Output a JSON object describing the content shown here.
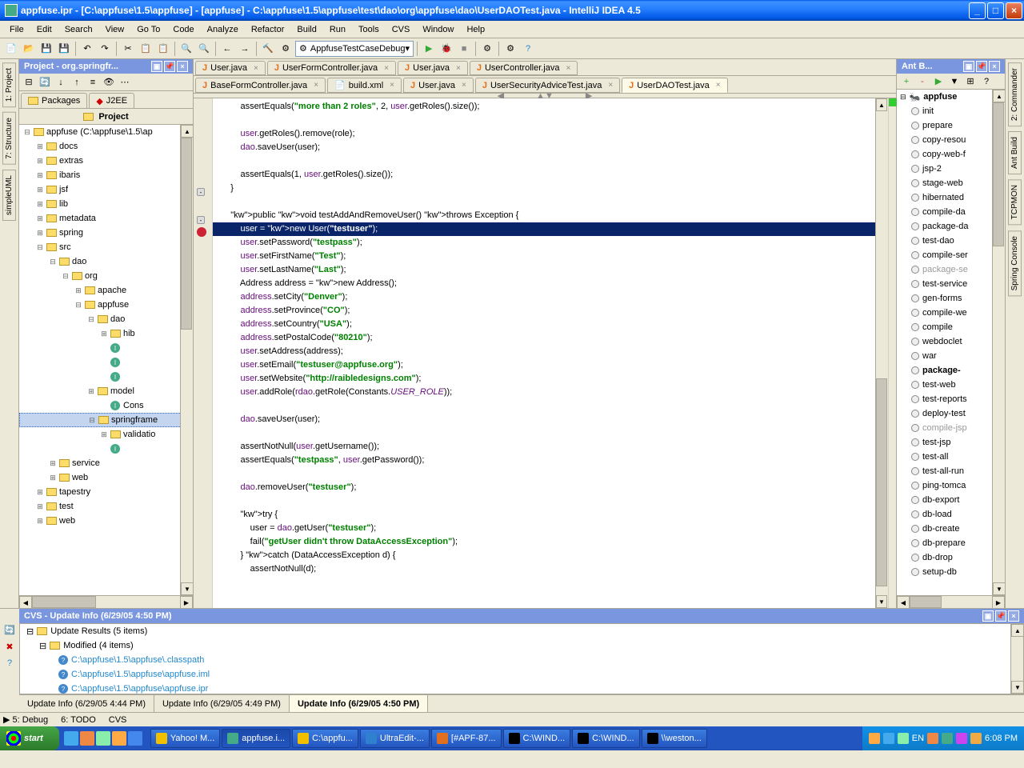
{
  "titlebar": {
    "text": "appfuse.ipr - [C:\\appfuse\\1.5\\appfuse] - [appfuse] - C:\\appfuse\\1.5\\appfuse\\test\\dao\\org\\appfuse\\dao\\UserDAOTest.java - IntelliJ IDEA 4.5"
  },
  "menu": [
    "File",
    "Edit",
    "Search",
    "View",
    "Go To",
    "Code",
    "Analyze",
    "Refactor",
    "Build",
    "Run",
    "Tools",
    "CVS",
    "Window",
    "Help"
  ],
  "toolbar": {
    "runconfig": "AppfuseTestCaseDebug"
  },
  "side_left": [
    "1: Project",
    "7: Structure",
    "simpleUML"
  ],
  "side_right": [
    "2: Commander",
    "Ant Build",
    "TCPMON",
    "Spring Console"
  ],
  "project": {
    "title": "Project - org.springfr...",
    "tabs": [
      "Packages",
      "J2EE"
    ],
    "header": "Project",
    "tree": [
      {
        "depth": 0,
        "exp": "-",
        "icon": "folder",
        "label": "appfuse (C:\\appfuse\\1.5\\ap"
      },
      {
        "depth": 1,
        "exp": "+",
        "icon": "folder",
        "label": "docs"
      },
      {
        "depth": 1,
        "exp": "+",
        "icon": "folder",
        "label": "extras"
      },
      {
        "depth": 1,
        "exp": "+",
        "icon": "folder",
        "label": "ibaris"
      },
      {
        "depth": 1,
        "exp": "+",
        "icon": "folder",
        "label": "jsf"
      },
      {
        "depth": 1,
        "exp": "+",
        "icon": "folder",
        "label": "lib"
      },
      {
        "depth": 1,
        "exp": "+",
        "icon": "folder",
        "label": "metadata"
      },
      {
        "depth": 1,
        "exp": "+",
        "icon": "folder",
        "label": "spring"
      },
      {
        "depth": 1,
        "exp": "-",
        "icon": "folder",
        "label": "src"
      },
      {
        "depth": 2,
        "exp": "-",
        "icon": "folder",
        "label": "dao"
      },
      {
        "depth": 3,
        "exp": "-",
        "icon": "folder",
        "label": "org"
      },
      {
        "depth": 4,
        "exp": "+",
        "icon": "folder",
        "label": "apache"
      },
      {
        "depth": 4,
        "exp": "-",
        "icon": "folder",
        "label": "appfuse"
      },
      {
        "depth": 5,
        "exp": "-",
        "icon": "folder",
        "label": "dao"
      },
      {
        "depth": 6,
        "exp": "+",
        "icon": "folder",
        "label": "hib"
      },
      {
        "depth": 6,
        "exp": "",
        "icon": "class",
        "label": ""
      },
      {
        "depth": 6,
        "exp": "",
        "icon": "class",
        "label": ""
      },
      {
        "depth": 6,
        "exp": "",
        "icon": "class",
        "label": ""
      },
      {
        "depth": 5,
        "exp": "+",
        "icon": "folder",
        "label": "model"
      },
      {
        "depth": 6,
        "exp": "",
        "icon": "class",
        "label": "Cons"
      },
      {
        "depth": 5,
        "exp": "-",
        "icon": "folder",
        "label": "springframe",
        "selected": true
      },
      {
        "depth": 6,
        "exp": "+",
        "icon": "folder",
        "label": "validatio"
      },
      {
        "depth": 6,
        "exp": "",
        "icon": "class",
        "label": ""
      },
      {
        "depth": 2,
        "exp": "+",
        "icon": "folder",
        "label": "service"
      },
      {
        "depth": 2,
        "exp": "+",
        "icon": "folder",
        "label": "web"
      },
      {
        "depth": 1,
        "exp": "+",
        "icon": "folder",
        "label": "tapestry"
      },
      {
        "depth": 1,
        "exp": "+",
        "icon": "folder",
        "label": "test"
      },
      {
        "depth": 1,
        "exp": "+",
        "icon": "folder",
        "label": "web"
      }
    ]
  },
  "editor": {
    "tabs_row1": [
      "User.java",
      "UserFormController.java",
      "User.java",
      "UserController.java"
    ],
    "tabs_row2": [
      "BaseFormController.java",
      "build.xml",
      "User.java",
      "UserSecurityAdviceTest.java",
      "UserDAOTest.java"
    ],
    "active_tab": "UserDAOTest.java"
  },
  "code_lines": [
    {
      "t": "        assertEquals(\"more than 2 roles\", 2, user.getRoles().size());",
      "h": [
        "str:more than 2 roles",
        "id:user"
      ]
    },
    {
      "t": ""
    },
    {
      "t": "        user.getRoles().remove(role);"
    },
    {
      "t": "        dao.saveUser(user);"
    },
    {
      "t": ""
    },
    {
      "t": "        assertEquals(1, user.getRoles().size());"
    },
    {
      "t": "    }"
    },
    {
      "t": ""
    },
    {
      "t": "    public void testAddAndRemoveUser() throws Exception {",
      "kw": [
        "public",
        "void",
        "throws"
      ]
    },
    {
      "t": "        user = new User(\"testuser\");",
      "selected": true,
      "kw": [
        "new"
      ],
      "str": [
        "testuser"
      ]
    },
    {
      "t": "        user.setPassword(\"testpass\");",
      "str": [
        "testpass"
      ]
    },
    {
      "t": "        user.setFirstName(\"Test\");",
      "str": [
        "Test"
      ]
    },
    {
      "t": "        user.setLastName(\"Last\");",
      "str": [
        "Last"
      ]
    },
    {
      "t": "        Address address = new Address();",
      "kw": [
        "new"
      ]
    },
    {
      "t": "        address.setCity(\"Denver\");",
      "str": [
        "Denver"
      ]
    },
    {
      "t": "        address.setProvince(\"CO\");",
      "str": [
        "CO"
      ]
    },
    {
      "t": "        address.setCountry(\"USA\");",
      "str": [
        "USA"
      ]
    },
    {
      "t": "        address.setPostalCode(\"80210\");",
      "str": [
        "80210"
      ]
    },
    {
      "t": "        user.setAddress(address);"
    },
    {
      "t": "        user.setEmail(\"testuser@appfuse.org\");",
      "str": [
        "testuser@appfuse.org"
      ]
    },
    {
      "t": "        user.setWebsite(\"http://raibledesigns.com\");",
      "str": [
        "http://raibledesigns.com"
      ]
    },
    {
      "t": "        user.addRole(rdao.getRole(Constants.USER_ROLE));",
      "stat": [
        "USER_ROLE"
      ]
    },
    {
      "t": ""
    },
    {
      "t": "        dao.saveUser(user);"
    },
    {
      "t": ""
    },
    {
      "t": "        assertNotNull(user.getUsername());"
    },
    {
      "t": "        assertEquals(\"testpass\", user.getPassword());",
      "str": [
        "testpass"
      ]
    },
    {
      "t": ""
    },
    {
      "t": "        dao.removeUser(\"testuser\");",
      "str": [
        "testuser"
      ]
    },
    {
      "t": ""
    },
    {
      "t": "        try {",
      "kw": [
        "try"
      ]
    },
    {
      "t": "            user = dao.getUser(\"testuser\");",
      "str": [
        "testuser"
      ]
    },
    {
      "t": "            fail(\"getUser didn't throw DataAccessException\");",
      "str": [
        "getUser didn't throw DataAccessException"
      ]
    },
    {
      "t": "        } catch (DataAccessException d) {",
      "kw": [
        "catch"
      ]
    },
    {
      "t": "            assertNotNull(d);"
    }
  ],
  "ant": {
    "title": "Ant B...",
    "root": "appfuse",
    "targets": [
      {
        "t": "init"
      },
      {
        "t": "prepare"
      },
      {
        "t": "copy-resou"
      },
      {
        "t": "copy-web-f"
      },
      {
        "t": "jsp-2"
      },
      {
        "t": "stage-web"
      },
      {
        "t": "hibernated"
      },
      {
        "t": "compile-da"
      },
      {
        "t": "package-da"
      },
      {
        "t": "test-dao"
      },
      {
        "t": "compile-ser"
      },
      {
        "t": "package-se",
        "gray": true
      },
      {
        "t": "test-service"
      },
      {
        "t": "gen-forms"
      },
      {
        "t": "compile-we"
      },
      {
        "t": "compile"
      },
      {
        "t": "webdoclet"
      },
      {
        "t": "war"
      },
      {
        "t": "package-",
        "bold": true
      },
      {
        "t": "test-web"
      },
      {
        "t": "test-reports"
      },
      {
        "t": "deploy-test"
      },
      {
        "t": "compile-jsp",
        "gray": true
      },
      {
        "t": "test-jsp"
      },
      {
        "t": "test-all"
      },
      {
        "t": "test-all-run"
      },
      {
        "t": "ping-tomca"
      },
      {
        "t": "db-export"
      },
      {
        "t": "db-load"
      },
      {
        "t": "db-create"
      },
      {
        "t": "db-prepare"
      },
      {
        "t": "db-drop"
      },
      {
        "t": "setup-db"
      }
    ]
  },
  "cvs": {
    "title": "CVS - Update Info (6/29/05 4:50 PM)",
    "root": "Update Results (5 items)",
    "modified": "Modified (4 items)",
    "files": [
      "C:\\appfuse\\1.5\\appfuse\\.classpath",
      "C:\\appfuse\\1.5\\appfuse\\appfuse.iml",
      "C:\\appfuse\\1.5\\appfuse\\appfuse.ipr"
    ],
    "tabs": [
      "Update Info (6/29/05 4:44 PM)",
      "Update Info (6/29/05 4:49 PM)",
      "Update Info (6/29/05 4:50 PM)"
    ]
  },
  "statusbar": {
    "left": "",
    "todo": "6: TODO"
  },
  "taskbar": {
    "start": "start",
    "tasks": [
      {
        "t": "Yahoo! M...",
        "icon": "#f0c000"
      },
      {
        "t": "appfuse.i...",
        "icon": "#4a8",
        "active": true
      },
      {
        "t": "C:\\appfu...",
        "icon": "#f0c000"
      },
      {
        "t": "UltraEdit-...",
        "icon": "#3080d0"
      },
      {
        "t": "[#APF-87...",
        "icon": "#e07020"
      },
      {
        "t": "C:\\WIND...",
        "icon": "#000"
      },
      {
        "t": "C:\\WIND...",
        "icon": "#000"
      },
      {
        "t": "\\\\weston...",
        "icon": "#000"
      }
    ],
    "tray": {
      "lang": "EN",
      "time": "6:08 PM"
    }
  }
}
